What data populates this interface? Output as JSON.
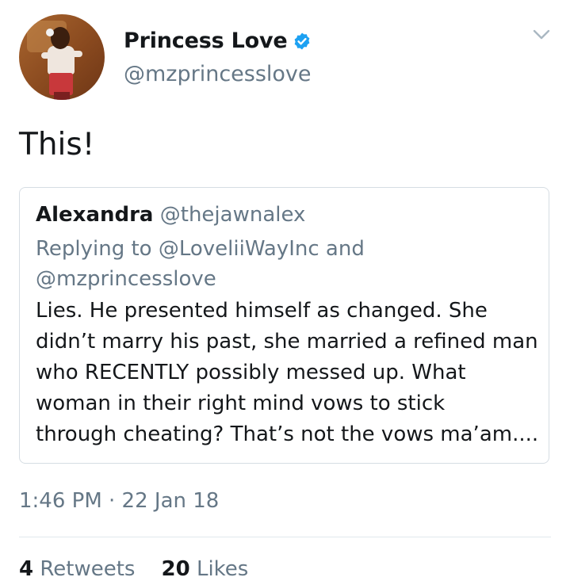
{
  "author": {
    "name": "Princess Love",
    "handle": "@mzprincesslove",
    "verified": true
  },
  "tweet": {
    "text": "This!",
    "timestamp": "1:46 PM · 22 Jan 18"
  },
  "quoted_tweet": {
    "name": "Alexandra",
    "handle": "@thejawnalex",
    "replying_to": [
      "Replying to @LoveliiWayInc and",
      "@mzprincesslove"
    ],
    "body_lines": [
      "Lies. He presented himself as changed. She",
      "didn’t marry his past, she married a refined man",
      "who RECENTLY possibly messed up. What",
      "woman in their right mind vows to stick",
      "through cheating? That’s not the vows ma’am...."
    ]
  },
  "stats": {
    "retweets_count": "4",
    "retweets_label": "Retweets",
    "likes_count": "20",
    "likes_label": "Likes"
  },
  "colors": {
    "text": "#14171a",
    "secondary": "#657786",
    "verified": "#1da1f2",
    "border": "#d6dde3"
  },
  "icons": [
    "verified-badge-icon",
    "chevron-down-icon"
  ]
}
